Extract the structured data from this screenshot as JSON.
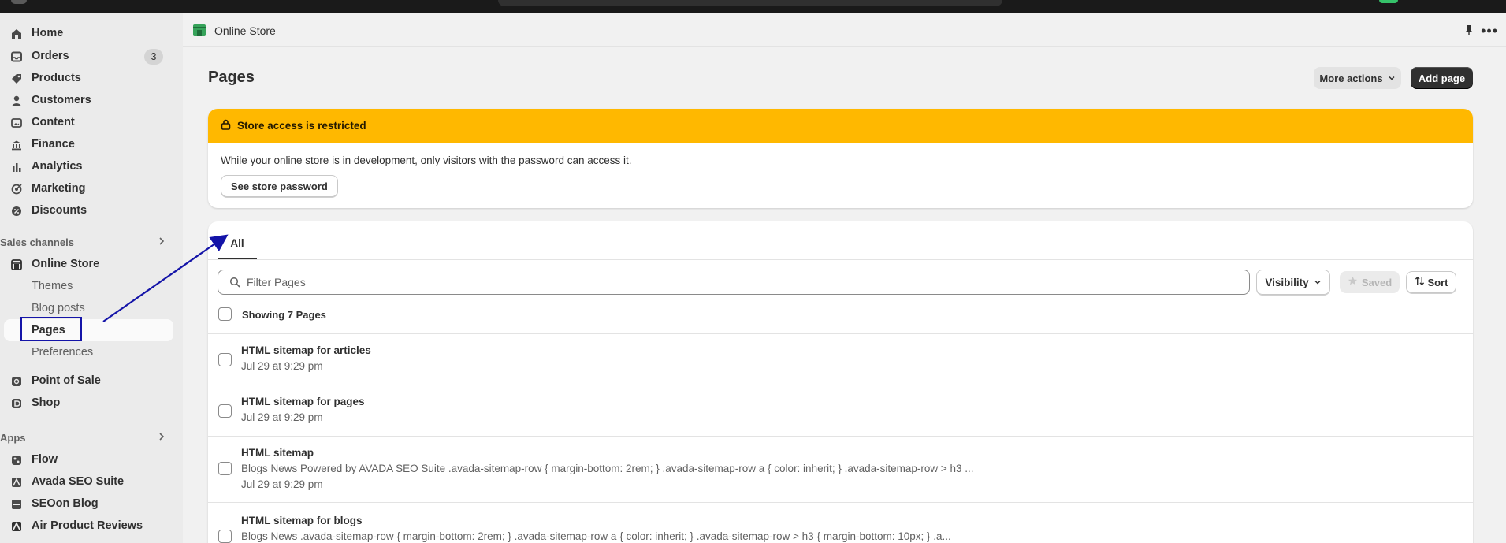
{
  "sidebar": {
    "items": [
      {
        "label": "Home",
        "icon": "home-icon"
      },
      {
        "label": "Orders",
        "icon": "inbox-icon",
        "badge": "3"
      },
      {
        "label": "Products",
        "icon": "tag-icon"
      },
      {
        "label": "Customers",
        "icon": "person-icon"
      },
      {
        "label": "Content",
        "icon": "image-icon"
      },
      {
        "label": "Finance",
        "icon": "bank-icon"
      },
      {
        "label": "Analytics",
        "icon": "bar-chart-icon"
      },
      {
        "label": "Marketing",
        "icon": "target-icon"
      },
      {
        "label": "Discounts",
        "icon": "discount-icon"
      }
    ],
    "sales_channels_header": "Sales channels",
    "online_store": "Online Store",
    "online_store_sub": [
      "Themes",
      "Blog posts",
      "Pages",
      "Preferences"
    ],
    "channels": [
      {
        "label": "Point of Sale",
        "icon": "pos-icon"
      },
      {
        "label": "Shop",
        "icon": "shop-icon"
      }
    ],
    "apps_header": "Apps",
    "apps": [
      {
        "label": "Flow",
        "icon": "flow-icon"
      },
      {
        "label": "Avada SEO Suite",
        "icon": "avada-icon"
      },
      {
        "label": "SEOon Blog",
        "icon": "seoon-icon"
      },
      {
        "label": "Air Product Reviews",
        "icon": "air-reviews-icon"
      }
    ]
  },
  "header": {
    "store_label": "Online Store"
  },
  "page": {
    "title": "Pages",
    "more_actions": "More actions",
    "add_page": "Add page"
  },
  "banner": {
    "title": "Store access is restricted",
    "message": "While your online store is in development, only visitors with the password can access it.",
    "button": "See store password",
    "color": "#ffb800"
  },
  "list": {
    "tab_all": "All",
    "filter_placeholder": "Filter Pages",
    "visibility": "Visibility",
    "saved": "Saved",
    "sort": "Sort",
    "showing": "Showing 7 Pages",
    "rows": [
      {
        "title": "HTML sitemap for articles",
        "date": "Jul 29 at 9:29 pm"
      },
      {
        "title": "HTML sitemap for pages",
        "date": "Jul 29 at 9:29 pm"
      },
      {
        "title": "HTML sitemap",
        "excerpt": "Blogs News Powered by AVADA SEO Suite .avada-sitemap-row { margin-bottom: 2rem; } .avada-sitemap-row a { color: inherit; } .avada-sitemap-row > h3 ...",
        "date": "Jul 29 at 9:29 pm"
      },
      {
        "title": "HTML sitemap for blogs",
        "excerpt": "Blogs News .avada-sitemap-row { margin-bottom: 2rem; } .avada-sitemap-row a { color: inherit; } .avada-sitemap-row > h3 { margin-bottom: 10px; } .a..."
      }
    ]
  },
  "annotation_color": "#1414a8"
}
